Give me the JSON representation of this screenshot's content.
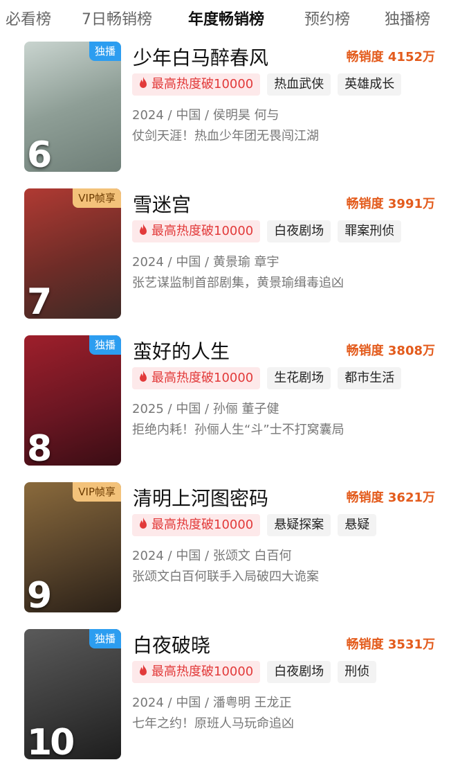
{
  "tabs": [
    "必看榜",
    "7日畅销榜",
    "年度畅销榜",
    "预约榜",
    "独播榜"
  ],
  "active_tab_index": 2,
  "items": [
    {
      "badge": "独播",
      "badge_type": "exclusive",
      "rank": "6",
      "title": "少年白马醉春风",
      "sales": "畅销度 4152万",
      "hot_tag": "最高热度破10000",
      "tags": [
        "热血武侠",
        "英雄成长"
      ],
      "meta": "2024 / 中国 / 侯明昊 何与",
      "desc": "仗剑天涯！热血少年团无畏闯江湖",
      "colors": [
        "#c9d4cf",
        "#6f7f78"
      ]
    },
    {
      "badge": "VIP帧享",
      "badge_type": "vip",
      "rank": "7",
      "title": "雪迷宫",
      "sales": "畅销度 3991万",
      "hot_tag": "最高热度破10000",
      "tags": [
        "白夜剧场",
        "罪案刑侦"
      ],
      "meta": "2024 / 中国 / 黄景瑜 章宇",
      "desc": "张艺谋监制首部剧集，黄景瑜缉毒追凶",
      "colors": [
        "#b03a33",
        "#3d2a26"
      ]
    },
    {
      "badge": "独播",
      "badge_type": "exclusive",
      "rank": "8",
      "title": "蛮好的人生",
      "sales": "畅销度 3808万",
      "hot_tag": "最高热度破10000",
      "tags": [
        "生花剧场",
        "都市生活"
      ],
      "meta": "2025 / 中国 / 孙俪 董子健",
      "desc": "拒绝内耗！孙俪人生“斗”士不打窝囊局",
      "colors": [
        "#9e1f2b",
        "#3a0d14"
      ]
    },
    {
      "badge": "VIP帧享",
      "badge_type": "vip",
      "rank": "9",
      "title": "清明上河图密码",
      "sales": "畅销度 3621万",
      "hot_tag": "最高热度破10000",
      "tags": [
        "悬疑探案",
        "悬疑"
      ],
      "meta": "2024 / 中国 / 张颂文 白百何",
      "desc": "张颂文白百何联手入局破四大诡案",
      "colors": [
        "#8a6a3c",
        "#2a2017"
      ]
    },
    {
      "badge": "独播",
      "badge_type": "exclusive",
      "rank": "10",
      "title": "白夜破晓",
      "sales": "畅销度 3531万",
      "hot_tag": "最高热度破10000",
      "tags": [
        "白夜剧场",
        "刑侦"
      ],
      "meta": "2024 / 中国 / 潘粤明 王龙正",
      "desc": "七年之约！原班人马玩命追凶",
      "colors": [
        "#5a5a5a",
        "#1e1e1e"
      ]
    }
  ],
  "accent": "#e35b1c"
}
